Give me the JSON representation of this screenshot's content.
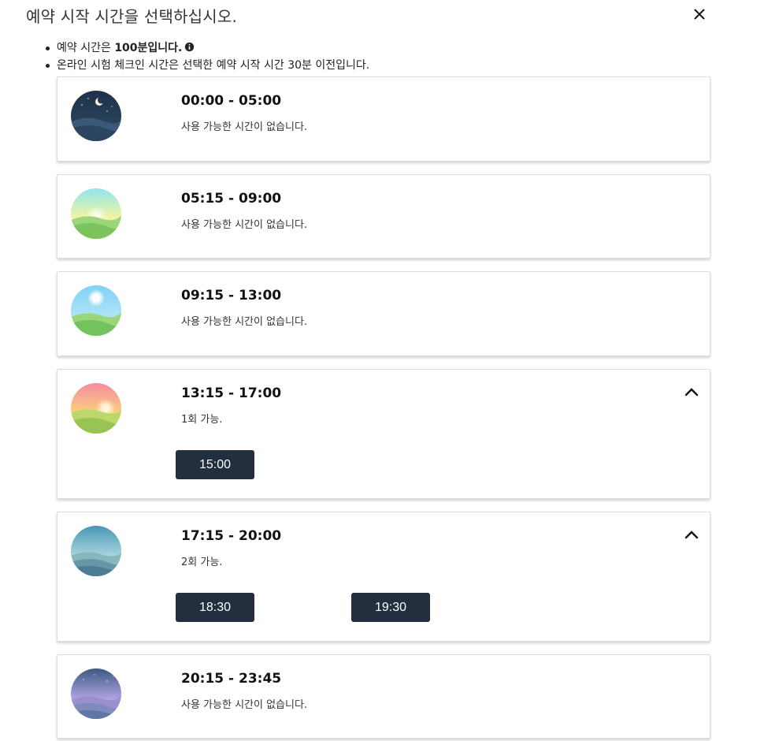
{
  "dialog": {
    "title": "예약 시작 시간을 선택하십시오.",
    "close_icon": "close-icon"
  },
  "notes": {
    "duration_prefix": "예약 시간은 ",
    "duration_bold": "100분입니다.",
    "info_icon": "info-icon",
    "checkin": "온라인 시험 체크인 시간은 선택한 예약 시작 시간 30분 이전입니다."
  },
  "slots": [
    {
      "range": "00:00 - 05:00",
      "status": "사용 가능한 시간이 없습니다.",
      "icon": "night-moon-icon",
      "colors": [
        "#1f3148",
        "#2f4a66"
      ]
    },
    {
      "range": "05:15 - 09:00",
      "status": "사용 가능한 시간이 없습니다.",
      "icon": "sunrise-icon",
      "colors": [
        "#8fe6ee",
        "#f4f5a0"
      ]
    },
    {
      "range": "09:15 - 13:00",
      "status": "사용 가능한 시간이 없습니다.",
      "icon": "day-sun-icon",
      "colors": [
        "#7fd2f4",
        "#cdeef8"
      ]
    },
    {
      "range": "13:15 - 17:00",
      "status": "1회 가능.",
      "icon": "sunset-icon",
      "colors": [
        "#f58aa0",
        "#f9d97a"
      ],
      "expand_icon": "chevron-up-icon",
      "times": [
        "15:00"
      ]
    },
    {
      "range": "17:15 - 20:00",
      "status": "2회 가능.",
      "icon": "evening-icon",
      "colors": [
        "#4a96b5",
        "#b7dfe6"
      ],
      "expand_icon": "chevron-up-icon",
      "times": [
        "18:30",
        "19:30"
      ]
    },
    {
      "range": "20:15 - 23:45",
      "status": "사용 가능한 시간이 없습니다.",
      "icon": "twilight-icon",
      "colors": [
        "#3c5a83",
        "#c3aef0"
      ]
    }
  ]
}
